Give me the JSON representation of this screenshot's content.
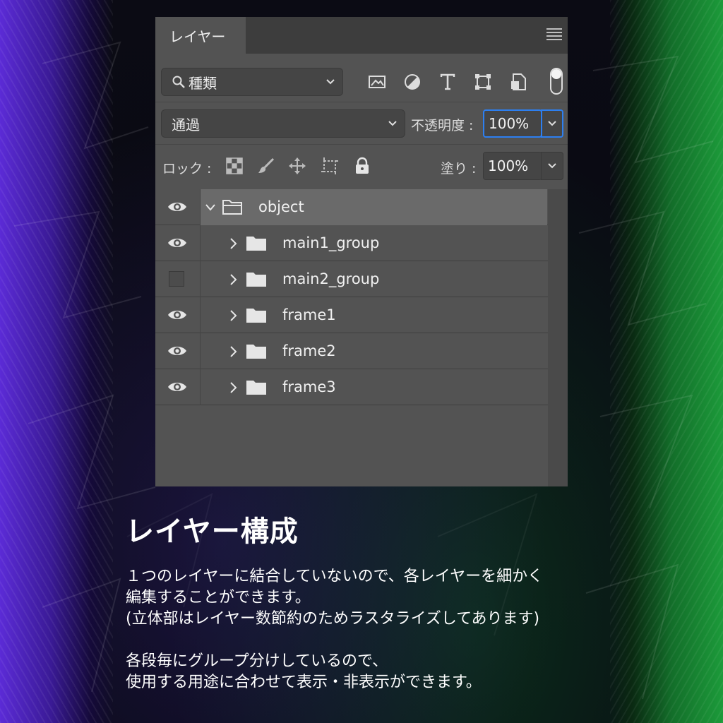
{
  "panel": {
    "tab_label": "レイヤー",
    "filter": {
      "label": "種類"
    },
    "blend": {
      "mode": "通過",
      "opacity_label": "不透明度 :",
      "opacity_value": "100%"
    },
    "lock": {
      "label": "ロック :",
      "fill_label": "塗り :",
      "fill_value": "100%"
    },
    "layers": [
      {
        "name": "object",
        "visible": true,
        "expanded": true,
        "indent": 0,
        "selected": true
      },
      {
        "name": "main1_group",
        "visible": true,
        "expanded": false,
        "indent": 1,
        "selected": false
      },
      {
        "name": "main2_group",
        "visible": false,
        "expanded": false,
        "indent": 1,
        "selected": false
      },
      {
        "name": "frame1",
        "visible": true,
        "expanded": false,
        "indent": 1,
        "selected": false
      },
      {
        "name": "frame2",
        "visible": true,
        "expanded": false,
        "indent": 1,
        "selected": false
      },
      {
        "name": "frame3",
        "visible": true,
        "expanded": false,
        "indent": 1,
        "selected": false
      }
    ]
  },
  "caption": {
    "title": "レイヤー構成",
    "lines": [
      "１つのレイヤーに結合していないので、各レイヤーを細かく",
      "編集することができます。",
      "(立体部はレイヤー数節約のためラスタライズしてあります)",
      "",
      "各段毎にグループ分けしているので、",
      "使用する用途に合わせて表示・非表示ができます。"
    ]
  },
  "colors": {
    "panel_bg": "#535353",
    "selected_row": "#6a6a6a",
    "focus_blue": "#2d7ff0",
    "left_accent": "#5b2bd6",
    "right_accent": "#1c9a3a"
  }
}
